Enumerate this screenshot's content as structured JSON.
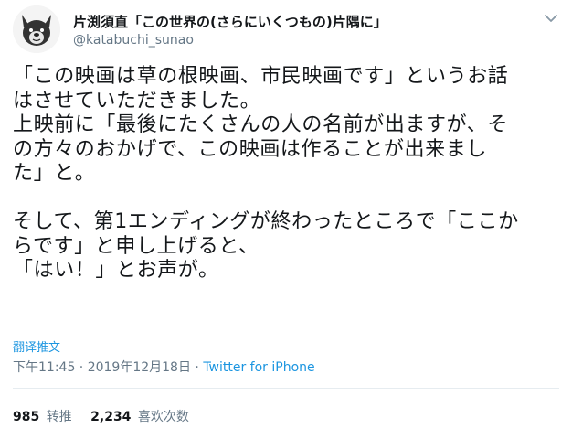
{
  "author": {
    "display_name": "片渕須直「この世界の(さらにいくつもの)片隅に」",
    "handle": "@katabuchi_sunao",
    "avatar_icon": "bulldog-avatar-icon"
  },
  "tweet": {
    "text": "「この映画は草の根映画、市民映画です」というお話\nはさせていただきました。\n上映前に「最後にたくさんの人の名前が出ますが、そ\nの方々のおかげで、この映画は作ることが出来まし\nた」と。\n\nそして、第1エンディングが終わったところで「ここか\nらです」と申し上げると、\n「はい！」とお声が。",
    "translate_label": "翻译推文",
    "time": "下午11:45 · 2019年12月18日 · ",
    "source": "Twitter for iPhone"
  },
  "stats": {
    "retweets_count": "985",
    "retweets_label": "转推",
    "likes_count": "2,234",
    "likes_label": "喜欢次数"
  },
  "colors": {
    "link": "#1b95e0",
    "muted": "#657786",
    "text": "#14171a"
  }
}
